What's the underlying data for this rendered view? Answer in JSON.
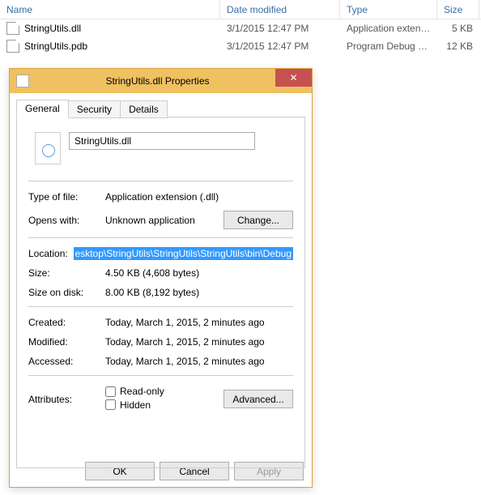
{
  "file_list": {
    "headers": {
      "name": "Name",
      "date": "Date modified",
      "type": "Type",
      "size": "Size"
    },
    "rows": [
      {
        "name": "StringUtils.dll",
        "date": "3/1/2015 12:47 PM",
        "type": "Application extens...",
        "size": "5 KB"
      },
      {
        "name": "StringUtils.pdb",
        "date": "3/1/2015 12:47 PM",
        "type": "Program Debug D...",
        "size": "12 KB"
      }
    ]
  },
  "dialog": {
    "title": "StringUtils.dll Properties",
    "tabs": {
      "general": "General",
      "security": "Security",
      "details": "Details"
    },
    "filename": "StringUtils.dll",
    "labels": {
      "type_of_file": "Type of file:",
      "opens_with": "Opens with:",
      "location": "Location:",
      "size": "Size:",
      "size_on_disk": "Size on disk:",
      "created": "Created:",
      "modified": "Modified:",
      "accessed": "Accessed:",
      "attributes": "Attributes:"
    },
    "values": {
      "type_of_file": "Application extension (.dll)",
      "opens_with": "Unknown application",
      "location": "esktop\\StringUtils\\StringUtils\\StringUtils\\bin\\Debug",
      "size": "4.50 KB (4,608 bytes)",
      "size_on_disk": "8.00 KB (8,192 bytes)",
      "created": "Today, March 1, 2015, 2 minutes ago",
      "modified": "Today, March 1, 2015, 2 minutes ago",
      "accessed": "Today, March 1, 2015, 2 minutes ago"
    },
    "buttons": {
      "change": "Change...",
      "advanced": "Advanced...",
      "ok": "OK",
      "cancel": "Cancel",
      "apply": "Apply"
    },
    "checkboxes": {
      "readonly": "Read-only",
      "hidden": "Hidden"
    }
  }
}
